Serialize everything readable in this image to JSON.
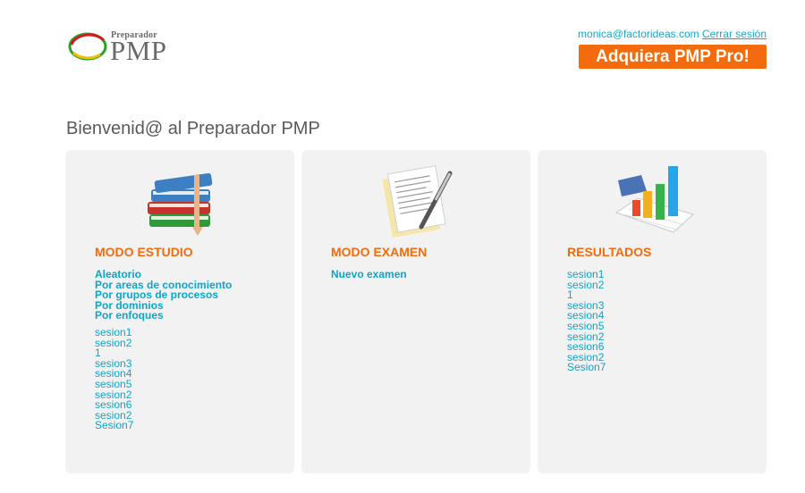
{
  "logo": {
    "small": "Preparador",
    "big": "PMP"
  },
  "header": {
    "user_email": "monica@factorideas.com",
    "logout_label": "Cerrar sesión",
    "pro_button": "Adquiera PMP Pro!"
  },
  "welcome": "Bienvenid@ al Preparador PMP",
  "colors": {
    "accent": "#f36b0c",
    "link": "#0aa6cc",
    "panel_bg": "#f2f2f2"
  },
  "study": {
    "title": "MODO ESTUDIO",
    "icon": "books-icon",
    "options": [
      "Aleatorio",
      "Por areas de conocimiento",
      "Por grupos de procesos",
      "Por dominios",
      "Por enfoques"
    ],
    "sessions": [
      "sesion1",
      "sesion2",
      "1",
      "sesion3",
      "sesion4",
      "sesion5",
      "sesion2",
      "sesion6",
      "sesion2",
      "Sesion7"
    ]
  },
  "exam": {
    "title": "MODO EXAMEN",
    "icon": "document-pen-icon",
    "options": [
      "Nuevo examen"
    ]
  },
  "results": {
    "title": "RESULTADOS",
    "icon": "bar-chart-icon",
    "sessions": [
      "sesion1",
      "sesion2",
      "1",
      "sesion3",
      "sesion4",
      "sesion5",
      "sesion2",
      "sesion6",
      "sesion2",
      "Sesion7"
    ]
  }
}
